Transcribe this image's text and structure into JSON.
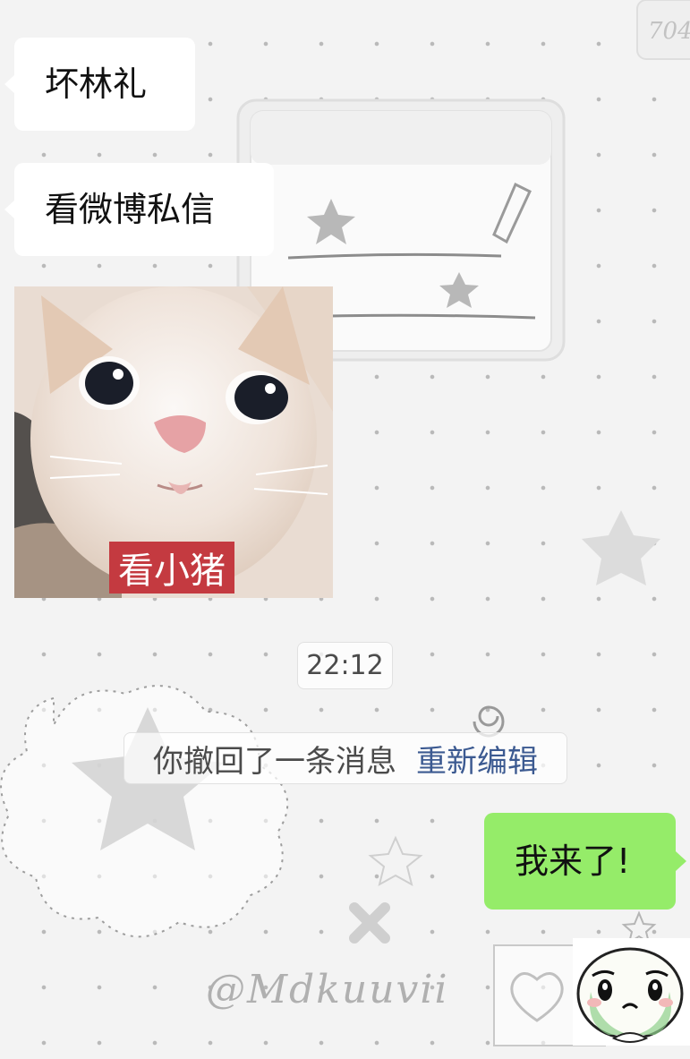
{
  "chat": {
    "messages": [
      {
        "type": "text",
        "side": "left",
        "text": "坏林礼"
      },
      {
        "type": "text",
        "side": "left",
        "text": "看微博私信"
      },
      {
        "type": "image",
        "side": "left",
        "subject": "kitten",
        "caption": "看小猪"
      },
      {
        "type": "time",
        "text": "22:12"
      },
      {
        "type": "system",
        "text": "你撤回了一条消息",
        "action": "重新编辑"
      },
      {
        "type": "text",
        "side": "right",
        "text": "我来了!"
      },
      {
        "type": "sticker",
        "side": "right",
        "subject": "crying-face-sticker"
      }
    ]
  },
  "background": {
    "watermark_top": "704",
    "watermark_bottom": "@Mdkuuvii"
  },
  "colors": {
    "outgoing_bubble": "#95ec69",
    "incoming_bubble": "#ffffff",
    "reedit_link": "#3c5a91",
    "caption_bg": "#c43a40"
  }
}
